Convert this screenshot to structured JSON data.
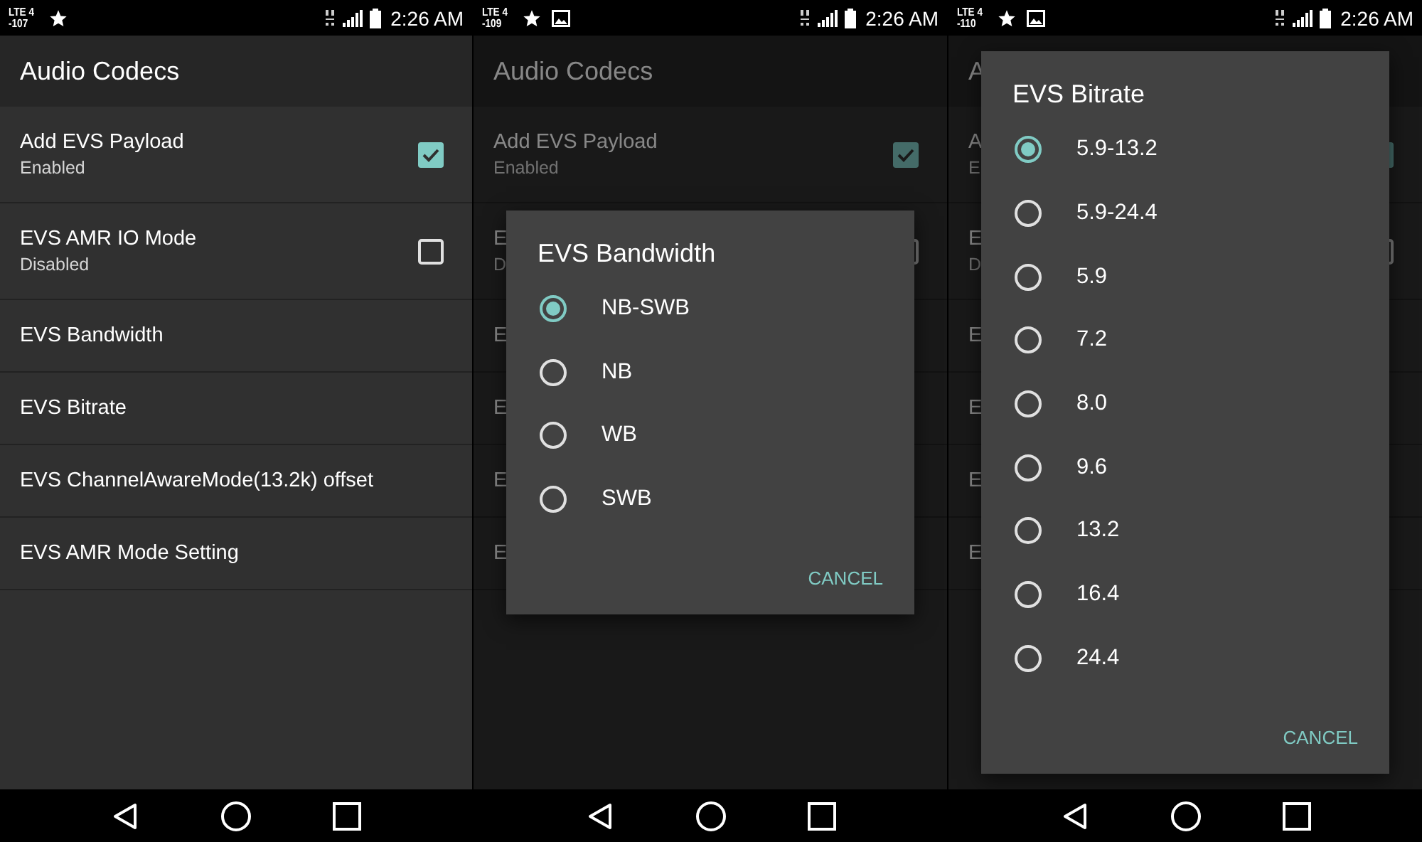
{
  "screens": [
    {
      "status_bar": {
        "network": "LTE 4",
        "signal": "-107",
        "notification_icons": [
          {
            "kind": "star"
          }
        ],
        "time": "2:26 AM"
      },
      "app_bar": {
        "title": "Audio Codecs"
      },
      "items": [
        {
          "kind": "checkbox",
          "title": "Add EVS Payload",
          "subtitle": "Enabled",
          "checked": true
        },
        {
          "kind": "checkbox",
          "title": "EVS AMR IO Mode",
          "subtitle": "Disabled",
          "checked": false
        },
        {
          "kind": "plain",
          "title": "EVS Bandwidth"
        },
        {
          "kind": "plain",
          "title": "EVS Bitrate"
        },
        {
          "kind": "plain",
          "title": "EVS ChannelAwareMode(13.2k) offset"
        },
        {
          "kind": "plain",
          "title": "EVS AMR Mode Setting"
        }
      ]
    },
    {
      "status_bar": {
        "network": "LTE 4",
        "signal": "-109",
        "notification_icons": [
          {
            "kind": "star"
          },
          {
            "kind": "image"
          }
        ],
        "time": "2:26 AM"
      },
      "app_bar": {
        "title": "Audio Codecs"
      },
      "items": [
        {
          "kind": "checkbox",
          "title": "Add EVS Payload",
          "subtitle": "Enabled",
          "checked": true
        },
        {
          "kind": "checkbox",
          "title": "E",
          "subtitle": "D",
          "checked": false
        },
        {
          "kind": "plain",
          "title": "E"
        },
        {
          "kind": "plain",
          "title": "E"
        },
        {
          "kind": "plain",
          "title": "E"
        },
        {
          "kind": "plain",
          "title": "E"
        }
      ],
      "dialog": {
        "title": "EVS Bandwidth",
        "options": [
          {
            "label": "NB-SWB",
            "selected": true
          },
          {
            "label": "NB",
            "selected": false
          },
          {
            "label": "WB",
            "selected": false
          },
          {
            "label": "SWB",
            "selected": false
          }
        ],
        "button": "CANCEL"
      }
    },
    {
      "status_bar": {
        "network": "LTE 4",
        "signal": "-110",
        "notification_icons": [
          {
            "kind": "star"
          },
          {
            "kind": "image"
          }
        ],
        "time": "2:26 AM"
      },
      "app_bar": {
        "title": "A"
      },
      "items": [
        {
          "kind": "checkbox",
          "title": "A",
          "subtitle": "E",
          "checked": true
        },
        {
          "kind": "checkbox",
          "title": "E",
          "subtitle": "D",
          "checked": false
        },
        {
          "kind": "plain",
          "title": "E"
        },
        {
          "kind": "plain",
          "title": "E"
        },
        {
          "kind": "plain",
          "title": "E"
        },
        {
          "kind": "plain",
          "title": "E"
        }
      ],
      "dialog": {
        "title": "EVS Bitrate",
        "options": [
          {
            "label": "5.9-13.2",
            "selected": true
          },
          {
            "label": "5.9-24.4",
            "selected": false
          },
          {
            "label": "5.9",
            "selected": false
          },
          {
            "label": "7.2",
            "selected": false
          },
          {
            "label": "8.0",
            "selected": false
          },
          {
            "label": "9.6",
            "selected": false
          },
          {
            "label": "13.2",
            "selected": false
          },
          {
            "label": "16.4",
            "selected": false
          },
          {
            "label": "24.4",
            "selected": false
          }
        ],
        "button": "CANCEL"
      }
    }
  ]
}
